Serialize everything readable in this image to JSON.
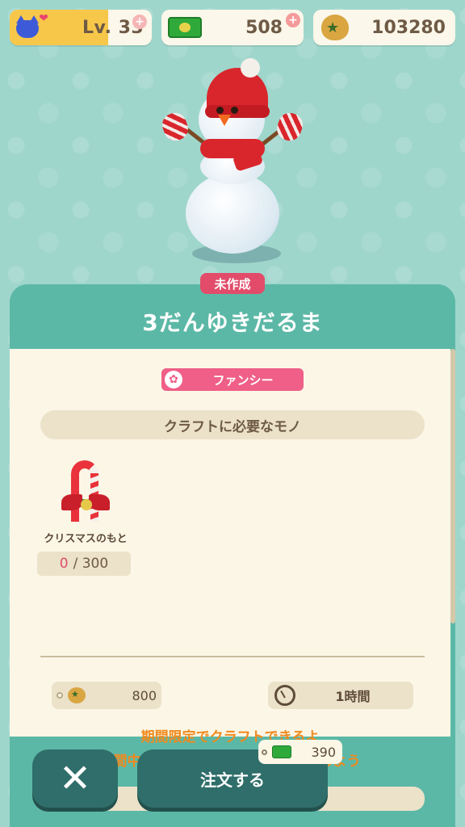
{
  "header": {
    "level_label": "Lv. 33",
    "tickets": "508",
    "bells": "103280"
  },
  "item": {
    "status": "未作成",
    "name": "3だんゆきだるま",
    "theme": "ファンシー"
  },
  "requirements": {
    "title": "クラフトに必要なモノ",
    "materials": [
      {
        "name": "クリスマスのもと",
        "have": "0",
        "need": "/ 300"
      }
    ]
  },
  "costs": {
    "bells": "800",
    "time": "1時間"
  },
  "notice": {
    "line1": "期間限定でクラフトできるよ",
    "line2": "期間中にクラフト材料を集めて注文しよう"
  },
  "actions": {
    "cancel_label": "✕",
    "order_label": "注文する",
    "order_ticket_cost": "390"
  },
  "colors": {
    "background": "#9fd6cc",
    "card": "#5cb8a6",
    "status_badge": "#e24c6a",
    "theme_tag": "#ef5f88",
    "notice": "#f08a1e",
    "button": "#2f6e6a"
  }
}
